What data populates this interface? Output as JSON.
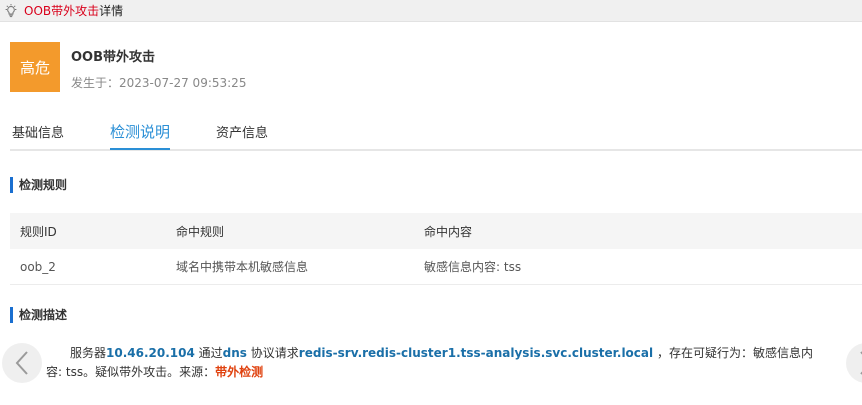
{
  "window": {
    "title_prefix": "OOB带外攻击",
    "title_suffix": "详情"
  },
  "alert": {
    "severity": "高危",
    "severity_color": "#f39a2c",
    "title": "OOB带外攻击",
    "time": "发生于：2023-07-27 09:53:25"
  },
  "tabs": [
    {
      "label": "基础信息",
      "active": false
    },
    {
      "label": "检测说明",
      "active": true
    },
    {
      "label": "资产信息",
      "active": false
    }
  ],
  "rules_section": {
    "title": "检测规则",
    "columns": [
      "规则ID",
      "命中规则",
      "命中内容"
    ],
    "rows": [
      [
        "oob_2",
        "域名中携带本机敏感信息",
        "敏感信息内容: tss"
      ]
    ]
  },
  "desc_section": {
    "title": "检测描述",
    "parts": {
      "p1": "服务器",
      "ip": "10.46.20.104",
      "p2": " 通过",
      "proto": "dns",
      "p3": " 协议请求",
      "domain": "redis-srv.redis-cluster1.tss-analysis.svc.cluster.local",
      "p4": " ，存在可疑行为：敏感信息内容: tss。疑似带外攻击。来源：",
      "source": "带外检测"
    }
  },
  "colors": {
    "accent": "#2a8fd6",
    "danger": "#d9001b",
    "highlight_blue": "#1a6fa8",
    "highlight_red": "#e0420f"
  },
  "icons": {
    "bulb": "lightbulb-icon",
    "prev": "chevron-left-icon",
    "next": "chevron-right-icon"
  }
}
